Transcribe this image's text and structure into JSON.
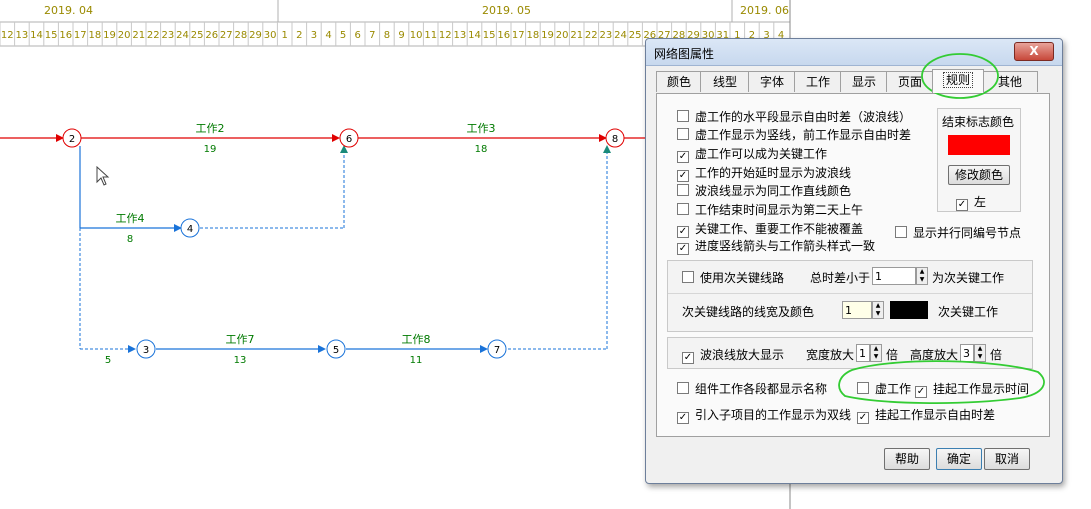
{
  "timeline": {
    "months": [
      {
        "label": "2019. 04"
      },
      {
        "label": "2019. 05"
      },
      {
        "label": "2019. 06"
      }
    ],
    "days": [
      "12",
      "13",
      "14",
      "15",
      "16",
      "17",
      "18",
      "19",
      "20",
      "21",
      "22",
      "23",
      "24",
      "25",
      "26",
      "27",
      "28",
      "29",
      "30",
      "1",
      "2",
      "3",
      "4",
      "5",
      "6",
      "7",
      "8",
      "9",
      "10",
      "11",
      "12",
      "13",
      "14",
      "15",
      "16",
      "17",
      "18",
      "19",
      "20",
      "21",
      "22",
      "23",
      "24",
      "25",
      "26",
      "27",
      "28",
      "29",
      "30",
      "31",
      "1",
      "2",
      "3",
      "4"
    ]
  },
  "network": {
    "nodes": [
      {
        "id": "2",
        "color": "#e00000"
      },
      {
        "id": "6",
        "color": "#e00000"
      },
      {
        "id": "8",
        "color": "#e00000"
      },
      {
        "id": "4",
        "color": "#1a73d9"
      },
      {
        "id": "3",
        "color": "#1a73d9"
      },
      {
        "id": "5",
        "color": "#1a73d9"
      },
      {
        "id": "7",
        "color": "#1a73d9"
      }
    ],
    "tasks": [
      {
        "name": "工作2",
        "duration": "19"
      },
      {
        "name": "工作3",
        "duration": "18"
      },
      {
        "name": "工作4",
        "duration": "8"
      },
      {
        "name": "工作7",
        "duration": "13"
      },
      {
        "name": "工作8",
        "duration": "11"
      }
    ],
    "dummy_label": "5",
    "colors": {
      "critical": "#e00000",
      "normal": "#1a73d9",
      "dummy": "#1a73d9",
      "text": "#007a00",
      "timeline_text": "#9a8a00"
    }
  },
  "dialog": {
    "title": "网络图属性",
    "close_label": "X",
    "tabs": [
      "颜色",
      "线型",
      "字体",
      "工作",
      "显示",
      "页面",
      "规则",
      "其他"
    ],
    "selected_tab": "规则",
    "options": [
      {
        "label": "虚工作的水平段显示自由时差（波浪线）",
        "checked": false
      },
      {
        "label": "虚工作显示为竖线，前工作显示自由时差",
        "checked": false
      },
      {
        "label": "虚工作可以成为关键工作",
        "checked": true
      },
      {
        "label": "工作的开始延时显示为波浪线",
        "checked": true
      },
      {
        "label": "波浪线显示为同工作直线颜色",
        "checked": false
      },
      {
        "label": "工作结束时间显示为第二天上午",
        "checked": false
      },
      {
        "label": "关键工作、重要工作不能被覆盖",
        "checked": true
      },
      {
        "label": "进度竖线箭头与工作箭头样式一致",
        "checked": true
      }
    ],
    "parallel_nodes": {
      "label": "显示并行同编号节点",
      "checked": false
    },
    "end_color": {
      "title": "结束标志颜色",
      "color": "#ff0000",
      "modify_label": "修改颜色",
      "left_label": "左",
      "left_checked": true
    },
    "sub_critical": {
      "use_label": "使用次关键线路",
      "use_checked": false,
      "float_label": "总时差小于",
      "float_value": "1",
      "suffix": "为次关键工作",
      "width_label": "次关键线路的线宽及颜色",
      "width_value": "1",
      "color": "#000000",
      "color_suffix": "次关键工作"
    },
    "wave": {
      "enlarge_label": "波浪线放大显示",
      "enlarge_checked": true,
      "width_label": "宽度放大",
      "width_value": "1",
      "width_unit": "倍",
      "height_label": "高度放大",
      "height_value": "3",
      "height_unit": "倍"
    },
    "bottom_options": {
      "component_label": "组件工作各段都显示名称",
      "component_checked": false,
      "dummy_label": "虚工作",
      "dummy_checked": false,
      "hang_time_label": "挂起工作显示时间",
      "hang_time_checked": true,
      "subproject_label": "引入子项目的工作显示为双线",
      "subproject_checked": true,
      "hang_float_label": "挂起工作显示自由时差",
      "hang_float_checked": true
    },
    "buttons": {
      "help": "帮助",
      "ok": "确定",
      "cancel": "取消"
    }
  },
  "annotation_color": "#33cc33"
}
